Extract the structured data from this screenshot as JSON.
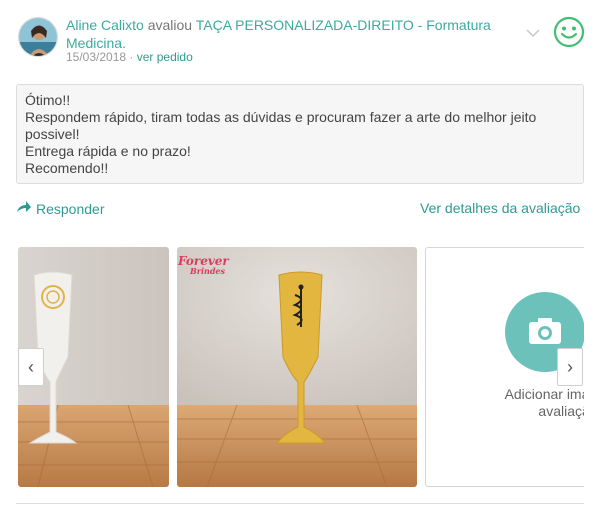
{
  "review": {
    "reviewer": "Aline Calixto",
    "action": "avaliou",
    "product": "TAÇA PERSONALIZADA-DIREITO - Formatura Medicina.",
    "date": "15/03/2018",
    "separator": " · ",
    "order_link": "ver pedido",
    "comment_lines": [
      "Ótimo!!",
      "Respondem rápido, tiram todas as dúvidas e procuram fazer a arte do melhor jeito possivel!",
      "Entrega rápida e no prazo!",
      "Recomendo!!"
    ],
    "sentiment_icon": "smiley-face-icon",
    "accent_color": "#3fa9a0"
  },
  "actions": {
    "reply_label": "Responder",
    "details_label": "Ver detalhes da avaliação"
  },
  "gallery": {
    "photo2_watermark_line1": "Forever",
    "photo2_watermark_line2": "Brindes",
    "add_image_label": "Adicionar imagens a avaliação",
    "prev_arrow": "‹",
    "next_arrow": "›"
  }
}
